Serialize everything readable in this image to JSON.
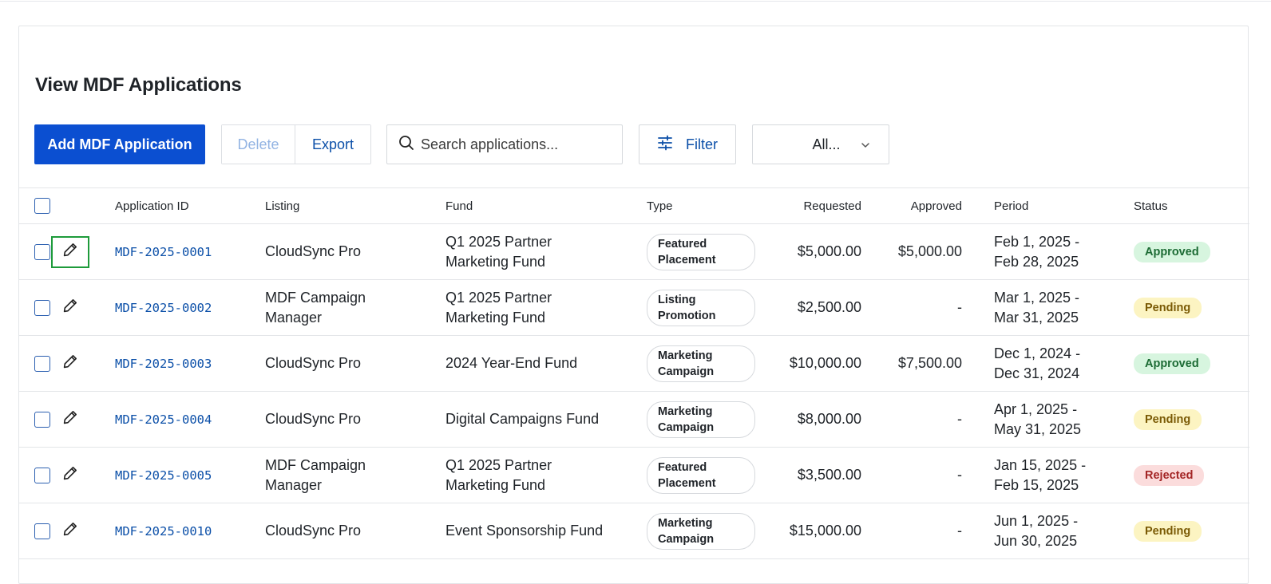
{
  "page": {
    "title": "View MDF Applications"
  },
  "toolbar": {
    "add_label": "Add MDF Application",
    "delete_label": "Delete",
    "export_label": "Export",
    "search_placeholder": "Search applications...",
    "filter_label": "Filter",
    "status_select_value": "All..."
  },
  "table": {
    "headers": {
      "app_id": "Application ID",
      "listing": "Listing",
      "fund": "Fund",
      "type": "Type",
      "requested": "Requested",
      "approved": "Approved",
      "period": "Period",
      "status": "Status"
    },
    "rows": [
      {
        "app_id": "MDF-2025-0001",
        "listing": [
          "CloudSync Pro"
        ],
        "fund": [
          "Q1 2025 Partner",
          "Marketing Fund"
        ],
        "type": [
          "Featured",
          "Placement"
        ],
        "requested": "$5,000.00",
        "approved": "$5,000.00",
        "period": [
          "Feb 1, 2025 -",
          "Feb 28, 2025"
        ],
        "status": "Approved",
        "status_kind": "approved",
        "focused": true
      },
      {
        "app_id": "MDF-2025-0002",
        "listing": [
          "MDF Campaign",
          "Manager"
        ],
        "fund": [
          "Q1 2025 Partner",
          "Marketing Fund"
        ],
        "type": [
          "Listing",
          "Promotion"
        ],
        "requested": "$2,500.00",
        "approved": "-",
        "period": [
          "Mar 1, 2025 -",
          "Mar 31, 2025"
        ],
        "status": "Pending",
        "status_kind": "pending",
        "focused": false
      },
      {
        "app_id": "MDF-2025-0003",
        "listing": [
          "CloudSync Pro"
        ],
        "fund": [
          "2024 Year-End Fund"
        ],
        "type": [
          "Marketing",
          "Campaign"
        ],
        "requested": "$10,000.00",
        "approved": "$7,500.00",
        "period": [
          "Dec 1, 2024 -",
          "Dec 31, 2024"
        ],
        "status": "Approved",
        "status_kind": "approved",
        "focused": false
      },
      {
        "app_id": "MDF-2025-0004",
        "listing": [
          "CloudSync Pro"
        ],
        "fund": [
          "Digital Campaigns Fund"
        ],
        "type": [
          "Marketing",
          "Campaign"
        ],
        "requested": "$8,000.00",
        "approved": "-",
        "period": [
          "Apr 1, 2025 -",
          "May 31, 2025"
        ],
        "status": "Pending",
        "status_kind": "pending",
        "focused": false
      },
      {
        "app_id": "MDF-2025-0005",
        "listing": [
          "MDF Campaign",
          "Manager"
        ],
        "fund": [
          "Q1 2025 Partner",
          "Marketing Fund"
        ],
        "type": [
          "Featured",
          "Placement"
        ],
        "requested": "$3,500.00",
        "approved": "-",
        "period": [
          "Jan 15, 2025 -",
          "Feb 15, 2025"
        ],
        "status": "Rejected",
        "status_kind": "rejected",
        "focused": false
      },
      {
        "app_id": "MDF-2025-0010",
        "listing": [
          "CloudSync Pro"
        ],
        "fund": [
          "Event Sponsorship Fund"
        ],
        "type": [
          "Marketing",
          "Campaign"
        ],
        "requested": "$15,000.00",
        "approved": "-",
        "period": [
          "Jun 1, 2025 -",
          "Jun 30, 2025"
        ],
        "status": "Pending",
        "status_kind": "pending",
        "focused": false
      }
    ]
  },
  "icons": {
    "search": "search-icon",
    "filter": "sliders-icon",
    "select": "chevron-down-icon",
    "edit": "pencil-icon"
  }
}
